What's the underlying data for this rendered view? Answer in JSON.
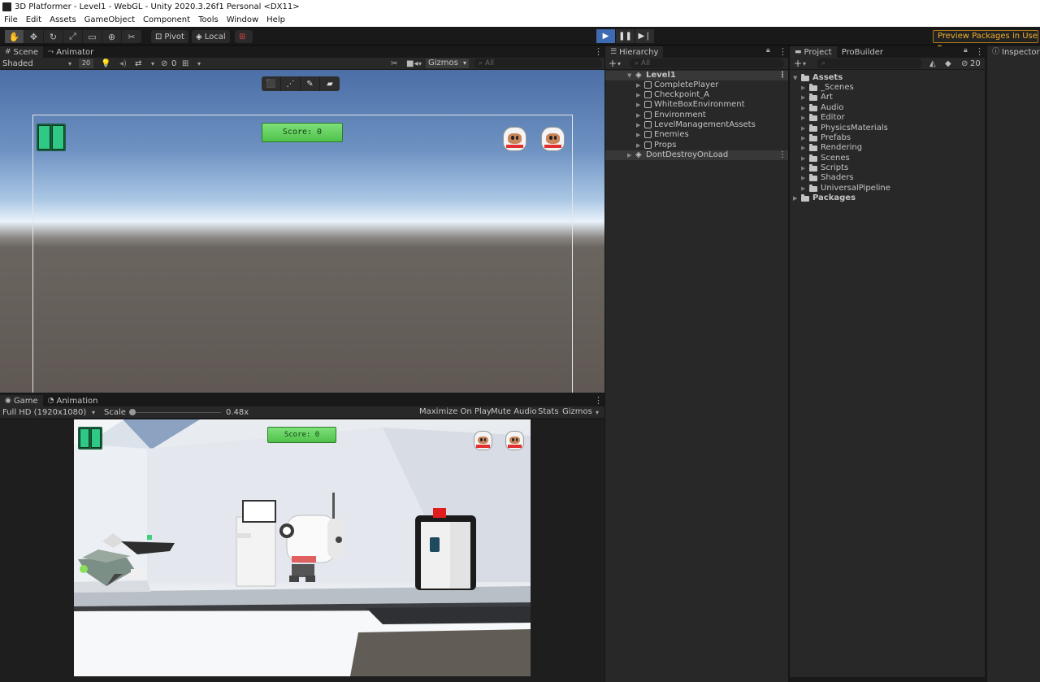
{
  "window": {
    "title": "3D Platformer - Level1 - WebGL - Unity 2020.3.26f1 Personal <DX11>"
  },
  "menu": [
    "File",
    "Edit",
    "Assets",
    "GameObject",
    "Component",
    "Tools",
    "Window",
    "Help"
  ],
  "toolbar": {
    "pivot_label": "Pivot",
    "local_label": "Local",
    "preview_packages": "Preview Packages in Use ▾"
  },
  "scene": {
    "tabs": [
      "Scene",
      "Animator"
    ],
    "shading": "Shaded",
    "mode_2d": "20",
    "hidden_count": "0",
    "gizmos": "Gizmos",
    "search_placeholder": "All",
    "score": "Score: 0"
  },
  "game": {
    "tabs": [
      "Game",
      "Animation"
    ],
    "resolution": "Full HD (1920x1080)",
    "scale_label": "Scale",
    "scale_value": "0.48x",
    "scale_fraction": 0.48,
    "options": [
      "Maximize On Play",
      "Mute Audio",
      "Stats",
      "Gizmos"
    ],
    "score": "Score: 0"
  },
  "hierarchy": {
    "title": "Hierarchy",
    "search_placeholder": "All",
    "scene_name": "Level1",
    "items": [
      "CompletePlayer",
      "Checkpoint_A",
      "WhiteBoxEnvironment",
      "Environment",
      "LevelManagementAssets",
      "Enemies",
      "Props"
    ],
    "ddol": "DontDestroyOnLoad"
  },
  "project": {
    "tabs": [
      "Project",
      "ProBuilder"
    ],
    "hidden_count": "20",
    "assets_label": "Assets",
    "folders": [
      "_Scenes",
      "Art",
      "Audio",
      "Editor",
      "PhysicsMaterials",
      "Prefabs",
      "Rendering",
      "Scenes",
      "Scripts",
      "Shaders",
      "UniversalPipeline"
    ],
    "packages_label": "Packages"
  },
  "inspector": {
    "title": "Inspector"
  },
  "colors": {
    "play_active": "#3d6ab0",
    "preview_border": "#b07a1a",
    "score_green": "#5fd05a"
  }
}
